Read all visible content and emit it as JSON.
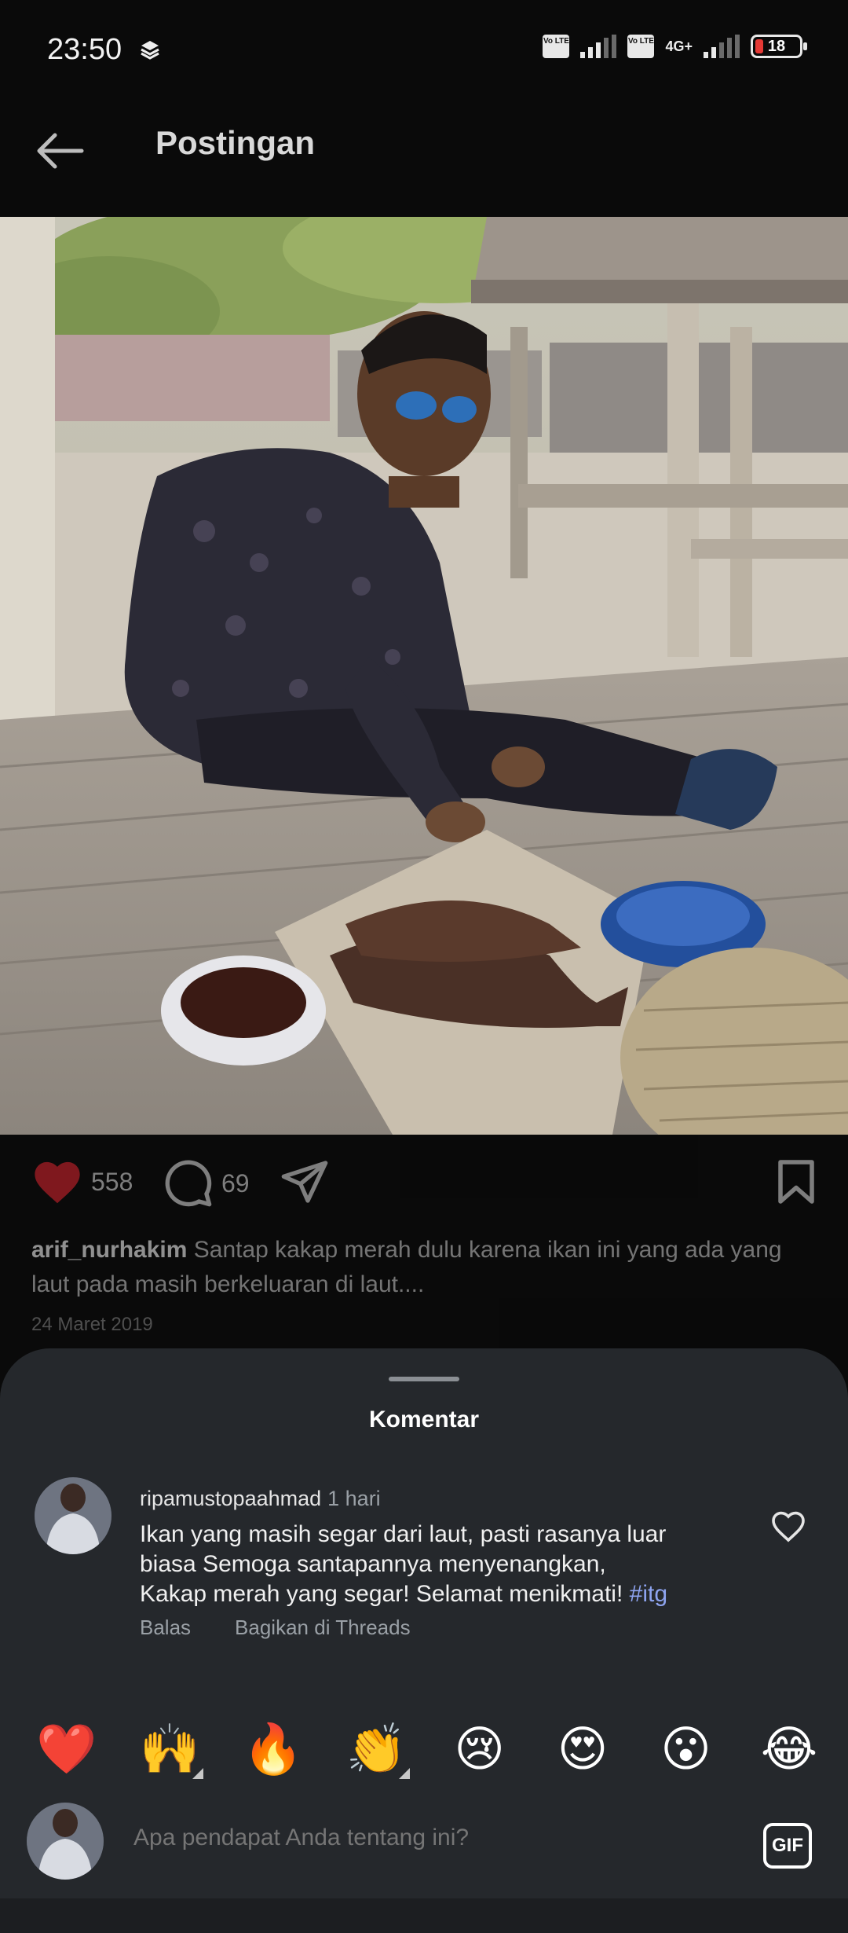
{
  "status_bar": {
    "time": "23:50",
    "sim1_label": "Vo LTE",
    "sim2_label": "Vo LTE",
    "network_type": "4G+",
    "battery_level": "18",
    "icons": [
      "layers-icon",
      "volte-icon",
      "signal-icon",
      "battery-icon"
    ]
  },
  "header": {
    "title": "Postingan",
    "back_icon": "arrow-left-icon"
  },
  "post": {
    "likes": "558",
    "comments": "69",
    "username": "arif_nurhakim",
    "caption": "Santap kakap merah dulu karena ikan ini yang ada yang laut pada masih berkeluaran di laut....",
    "date": "24 Maret 2019",
    "liked": true,
    "colors": {
      "like_red": "#e0242f"
    }
  },
  "comments_sheet": {
    "title": "Komentar",
    "comment": {
      "username": "ripamustopaahmad",
      "time": "1 hari",
      "text_line1": "Ikan yang masih segar dari laut, pasti rasanya luar",
      "text_line2": "biasa Semoga santapannya menyenangkan,",
      "text_line3": "Kakap merah yang segar! Selamat menikmati!",
      "hashtag": "#itg",
      "reply_label": "Balas",
      "share_label": "Bagikan di Threads"
    },
    "emojis": [
      "❤️",
      "🙌",
      "🔥",
      "👏",
      "😢",
      "😍",
      "😮",
      "😂"
    ],
    "input_placeholder": "Apa pendapat Anda tentang ini?",
    "gif_label": "GIF"
  }
}
